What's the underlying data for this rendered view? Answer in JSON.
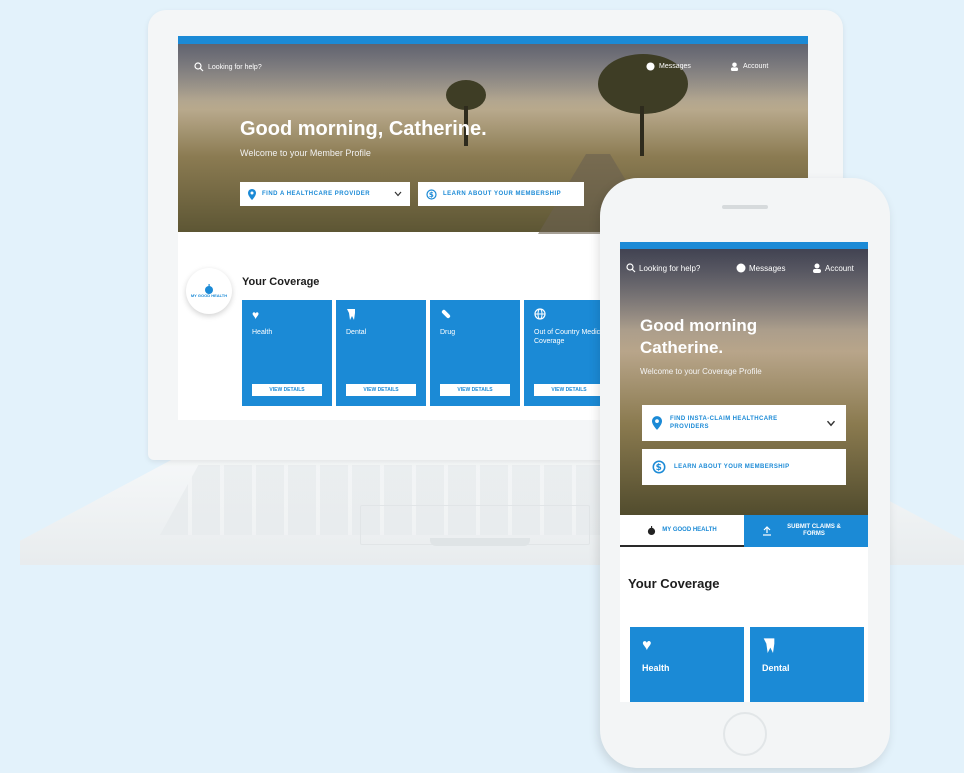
{
  "laptop": {
    "help_text": "Looking for help?",
    "messages_label": "Messages",
    "account_label": "Account",
    "greeting": "Good morning, Catherine.",
    "welcome": "Welcome to your Member Profile",
    "find_provider_label": "FIND A HEALTHCARE PROVIDER",
    "learn_label": "LEARN ABOUT YOUR MEMBERSHIP",
    "my_good_health_label": "MY GOOD HEALTH",
    "coverage_title": "Your Coverage",
    "tiles": [
      {
        "icon": "heart-icon",
        "name": "Health",
        "action": "VIEW DETAILS"
      },
      {
        "icon": "tooth-icon",
        "name": "Dental",
        "action": "VIEW DETAILS"
      },
      {
        "icon": "pill-icon",
        "name": "Drug",
        "action": "VIEW DETAILS"
      },
      {
        "icon": "globe-icon",
        "name": "Out of Country Medical Coverage",
        "action": "VIEW DETAILS"
      }
    ]
  },
  "phone": {
    "help_text": "Looking for help?",
    "messages_label": "Messages",
    "account_label": "Account",
    "greeting": "Good morning Catherine.",
    "welcome": "Welcome to your Coverage Profile",
    "find_provider_label": "FIND INSTA-CLAIM HEALTHCARE PROVIDERS",
    "learn_label": "LEARN ABOUT YOUR MEMBERSHIP",
    "tab_good_health": "MY GOOD HEALTH",
    "tab_submit": "SUBMIT CLAIMS & FORMS",
    "coverage_title": "Your Coverage",
    "tiles": [
      {
        "icon": "heart-icon",
        "name": "Health"
      },
      {
        "icon": "tooth-icon",
        "name": "Dental"
      }
    ]
  },
  "colors": {
    "accent": "#1b8ad6",
    "background": "#e3f2fb"
  }
}
